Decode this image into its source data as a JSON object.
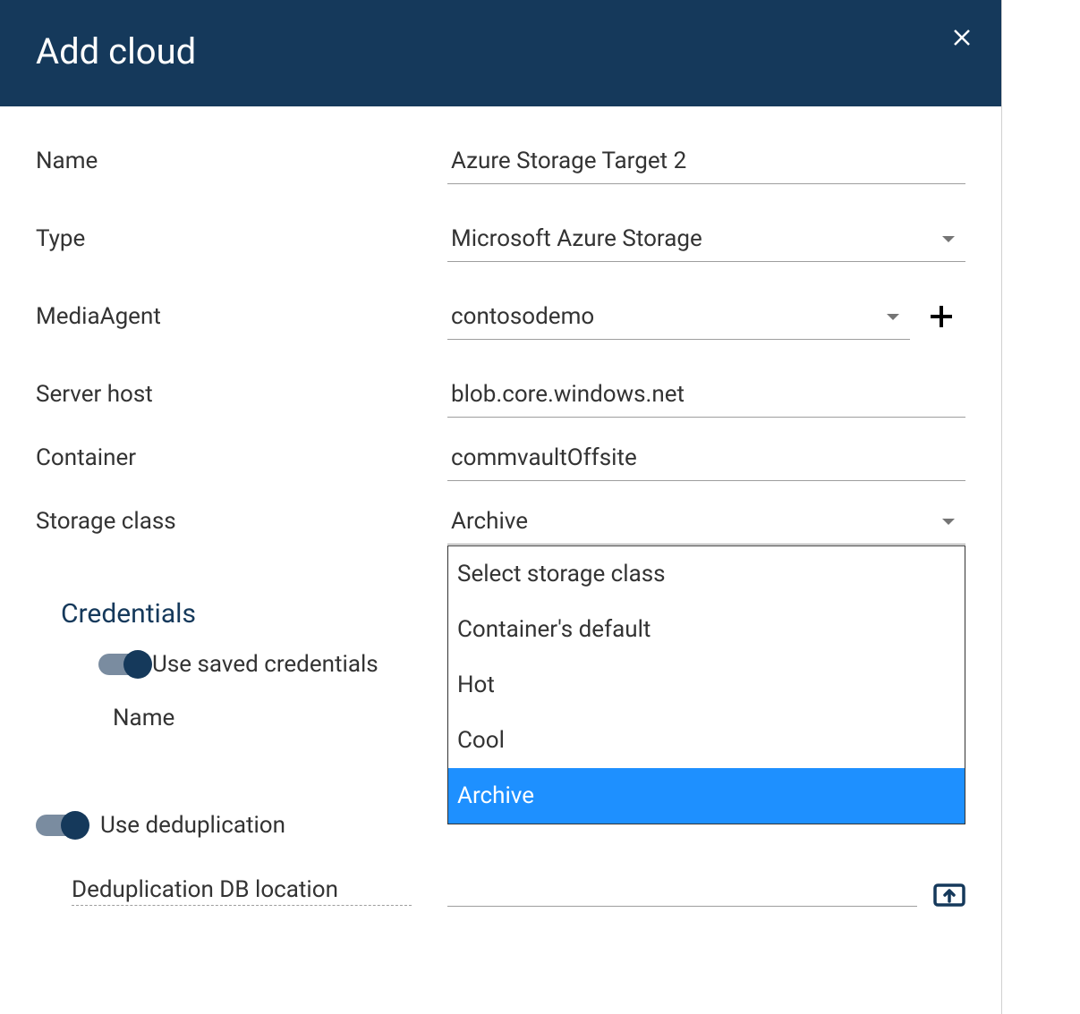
{
  "header": {
    "title": "Add cloud"
  },
  "form": {
    "name_label": "Name",
    "name_value": "Azure Storage Target 2",
    "type_label": "Type",
    "type_value": "Microsoft Azure Storage",
    "mediaagent_label": "MediaAgent",
    "mediaagent_value": "contosodemo",
    "serverhost_label": "Server host",
    "serverhost_value": "blob.core.windows.net",
    "container_label": "Container",
    "container_value": "commvaultOffsite",
    "storageclass_label": "Storage class",
    "storageclass_value": "Archive",
    "storageclass_options": [
      {
        "label": "Select storage class",
        "selected": false
      },
      {
        "label": "Container's default",
        "selected": false
      },
      {
        "label": "Hot",
        "selected": false
      },
      {
        "label": "Cool",
        "selected": false
      },
      {
        "label": "Archive",
        "selected": true
      }
    ]
  },
  "credentials": {
    "heading": "Credentials",
    "use_saved_label": "Use saved credentials",
    "name_label": "Name"
  },
  "dedup": {
    "use_dedup_label": "Use deduplication",
    "db_location_label": "Deduplication DB location"
  }
}
